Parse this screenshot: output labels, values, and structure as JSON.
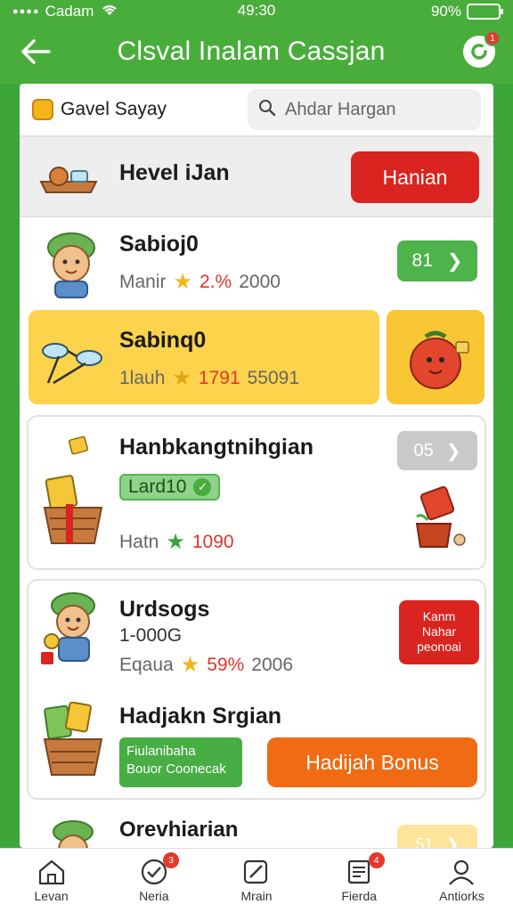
{
  "status_bar": {
    "carrier": "Cadam",
    "time": "49:30",
    "battery": "90%"
  },
  "header": {
    "title": "Clsval Inalam Cassjan",
    "notif_badge": "1"
  },
  "search": {
    "brand_label": "Gavel Sayay",
    "placeholder": "Ahdar Hargan"
  },
  "rows": {
    "r1": {
      "label": "Hevel iJan",
      "button": "Hanian"
    },
    "r2": {
      "name": "Sabioj0",
      "meta_left": "Manir",
      "percent": "2.%",
      "count": "2000",
      "button": "81"
    },
    "r3": {
      "name": "Sabinq0",
      "meta_left": "1lauh",
      "percent": "1791",
      "count": "55091"
    },
    "c1": {
      "name": "Hanbkangtnihgian",
      "tag": "Lard10",
      "meta_left": "Hatn",
      "percent": "1090",
      "button": "05"
    },
    "c2": {
      "name": "Urdsogs",
      "sub": "1-000G",
      "meta_left": "Eqaua",
      "percent": "59%",
      "count": "2006",
      "badge_lines": [
        "Kanm",
        "Nahar",
        "peonoai"
      ],
      "name2": "Hadjakn Srgian",
      "box_lines": [
        "Fiulanibaha",
        "Bouor Coonecak"
      ],
      "cta": "Hadijah Bonus"
    },
    "last": {
      "name": "Orevhiarian",
      "button": "51"
    }
  },
  "bottom_nav": [
    {
      "label": "Levan",
      "icon": "home-icon"
    },
    {
      "label": "Neria",
      "icon": "checklist-icon",
      "badge": "3"
    },
    {
      "label": "Mrain",
      "icon": "edit-icon"
    },
    {
      "label": "Fierda",
      "icon": "document-icon",
      "badge": "4"
    },
    {
      "label": "Antiorks",
      "icon": "profile-icon"
    }
  ],
  "colors": {
    "green": "#49ad3c",
    "red": "#d9241f",
    "orange": "#f06b13",
    "yellow": "#fcd34a"
  }
}
